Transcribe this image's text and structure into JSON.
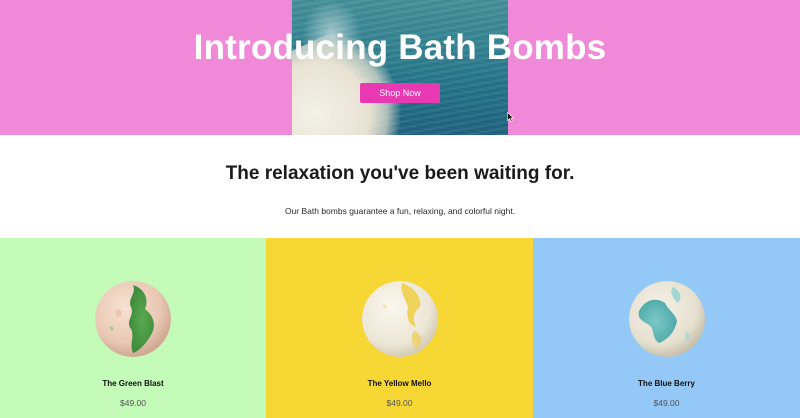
{
  "hero": {
    "title": "Introducing Bath Bombs",
    "button_label": "Shop Now",
    "background_color": "#f08ad8",
    "button_color": "#e838b2",
    "image_icon": "ocean-photo"
  },
  "intro": {
    "heading": "The relaxation you've been waiting for.",
    "text": "Our Bath bombs guarantee a fun, relaxing, and colorful night."
  },
  "products": [
    {
      "name": "The Green Blast",
      "price": "$49.00",
      "background_color": "#c4fbb8",
      "accent_color": "#4a9a45"
    },
    {
      "name": "The Yellow Mello",
      "price": "$49.00",
      "background_color": "#f6d733",
      "accent_color": "#e8c842"
    },
    {
      "name": "The Blue Berry",
      "price": "$49.00",
      "background_color": "#94c8f6",
      "accent_color": "#5bb3b0"
    }
  ]
}
